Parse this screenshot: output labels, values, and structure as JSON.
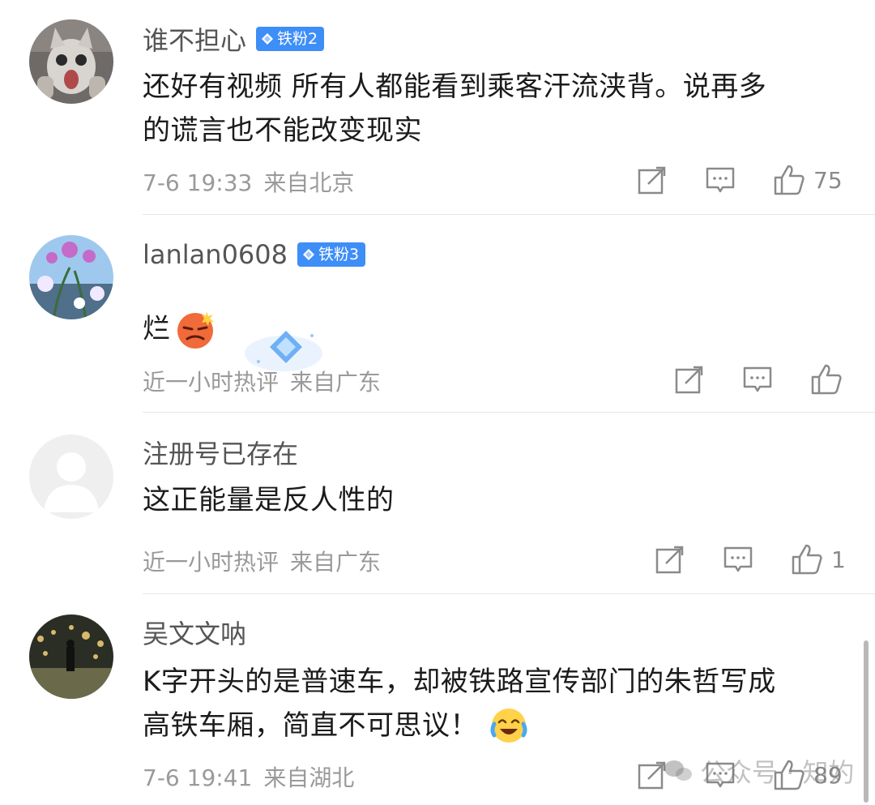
{
  "comments": [
    {
      "username": "谁不担心",
      "badge": "铁粉2",
      "text_lines": [
        "还好有视频 所有人都能看到乘客汗流浃背。说再多",
        "的谎言也不能改变现实"
      ],
      "time": "7-6 19:33",
      "location": "来自北京",
      "likes": "75"
    },
    {
      "username": "lanlan0608",
      "badge": "铁粉3",
      "text": "烂",
      "time": "近一小时热评",
      "location": "来自广东",
      "likes": ""
    },
    {
      "username": "注册号已存在",
      "text": "这正能量是反人性的",
      "time": "近一小时热评",
      "location": "来自广东",
      "likes": "1"
    },
    {
      "username": "吴文文呐",
      "text_lines": [
        "K字开头的是普速车，却被铁路宣传部门的朱哲写成",
        "高铁车厢，简直不可思议！"
      ],
      "time": "7-6 19:41",
      "location": "来自湖北",
      "likes": "89"
    }
  ],
  "watermark": "公众号 · 知妁",
  "icons": [
    "share-icon",
    "comment-icon",
    "like-icon",
    "diamond-icon",
    "angry-emoji",
    "laugh-cry-emoji"
  ],
  "colors": {
    "badge": "#3e8ef7",
    "meta": "#9a9a9a",
    "divider": "#e6e6e6"
  }
}
